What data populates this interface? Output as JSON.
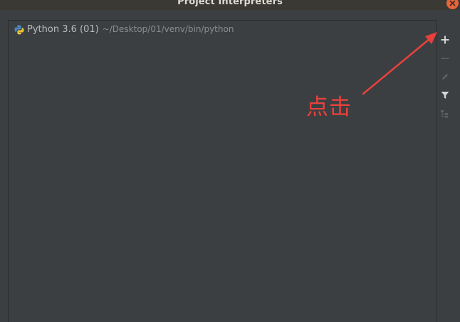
{
  "window": {
    "title": "Project Interpreters"
  },
  "interpreters": [
    {
      "name": "Python 3.6 (01)",
      "path": "~/Desktop/01/venv/bin/python",
      "icon": "python-icon"
    }
  ],
  "toolbar": {
    "items": [
      {
        "icon": "plus-icon",
        "enabled": true
      },
      {
        "icon": "minus-icon",
        "enabled": false
      },
      {
        "icon": "pencil-icon",
        "enabled": false
      },
      {
        "icon": "filter-icon",
        "enabled": true
      },
      {
        "icon": "tree-icon",
        "enabled": false
      }
    ]
  },
  "annotation": {
    "text": "点击",
    "color": "#e8413c"
  },
  "colors": {
    "background": "#3c3f41",
    "titlebar": "#3a3934",
    "close_button": "#e8643a",
    "text": "#bbbbbb",
    "path_text": "#8c8c8c"
  }
}
